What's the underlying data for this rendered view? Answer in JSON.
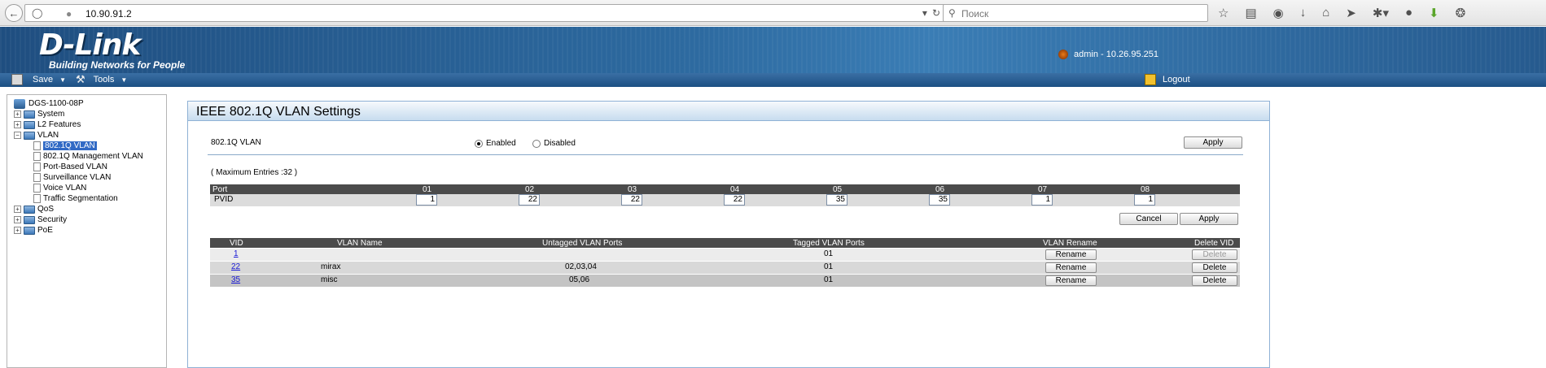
{
  "browser": {
    "url": "10.90.91.2",
    "search_placeholder": "Поиск"
  },
  "banner": {
    "logo": "D-Link",
    "tagline": "Building Networks for People",
    "user": "admin - 10.26.95.251"
  },
  "menu": {
    "save": "Save",
    "tools": "Tools",
    "logout": "Logout"
  },
  "tree": {
    "root": "DGS-1100-08P",
    "items": [
      "System",
      "L2 Features",
      "VLAN",
      "QoS",
      "Security",
      "PoE"
    ],
    "vlan_children": [
      "802.1Q VLAN",
      "802.1Q Management VLAN",
      "Port-Based VLAN",
      "Surveillance VLAN",
      "Voice VLAN",
      "Traffic Segmentation"
    ]
  },
  "panel": {
    "title": "IEEE 802.1Q VLAN Settings",
    "vlan_label": "802.1Q VLAN",
    "enabled": "Enabled",
    "disabled": "Disabled",
    "apply": "Apply",
    "max_entries": "( Maximum Entries :32 )",
    "cancel": "Cancel"
  },
  "pvid_table": {
    "port_label": "Port",
    "pvid_label": "PVID",
    "ports": [
      "01",
      "02",
      "03",
      "04",
      "05",
      "06",
      "07",
      "08"
    ],
    "pvids": [
      "1",
      "22",
      "22",
      "22",
      "35",
      "35",
      "1",
      "1"
    ]
  },
  "vlan_table": {
    "headers": [
      "VID",
      "VLAN Name",
      "Untagged VLAN Ports",
      "Tagged VLAN Ports",
      "VLAN Rename",
      "Delete VID"
    ],
    "rename": "Rename",
    "delete": "Delete",
    "rows": [
      {
        "vid": "1",
        "name": "",
        "untagged": "",
        "tagged": "01"
      },
      {
        "vid": "22",
        "name": "mirax",
        "untagged": "02,03,04",
        "tagged": "01"
      },
      {
        "vid": "35",
        "name": "misc",
        "untagged": "05,06",
        "tagged": "01"
      }
    ]
  }
}
